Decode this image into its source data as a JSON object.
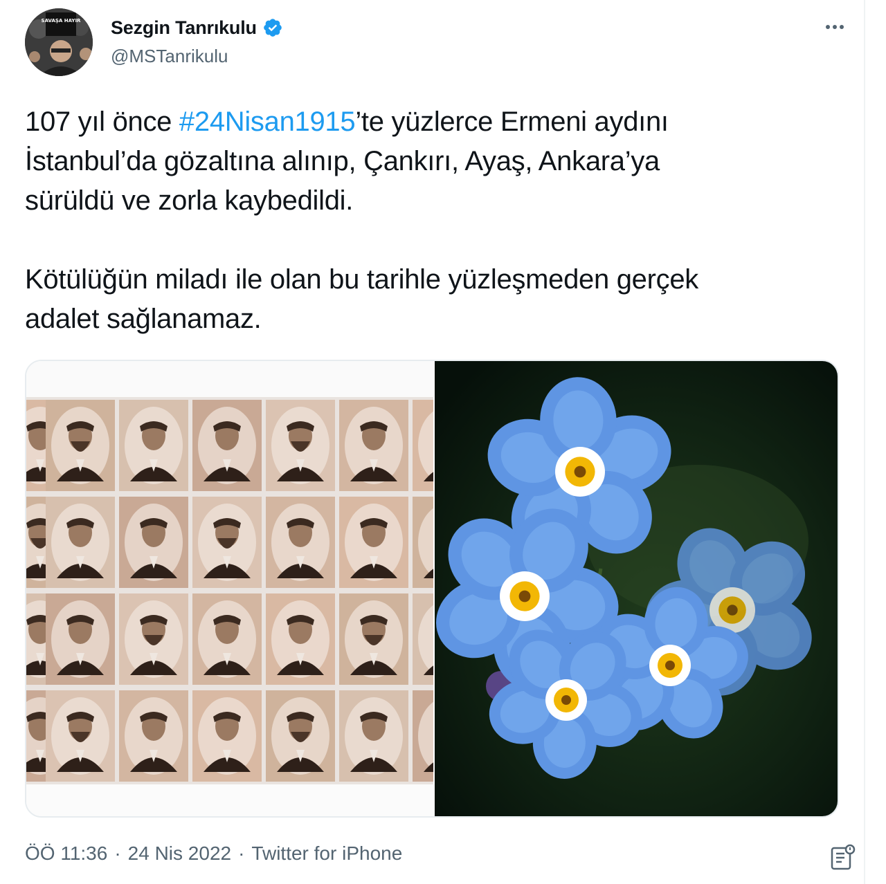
{
  "author": {
    "name": "Sezgin Tanrıkulu",
    "handle": "@MSTanrikulu",
    "avatar_sign": "SAVAŞA HAYIR",
    "verified_color": "#1d9bf0"
  },
  "tweet": {
    "text_part1": "107 yıl önce ",
    "hashtag": "#24Nisan1915",
    "text_part2": "’te yüzlerce Ermeni aydını\nİstanbul’da gözaltına alınıp, Çankırı, Ayaş, Ankara’ya\nsürüldü ve zorla kaybedildi.",
    "paragraph2": "Kötülüğün miladı ile olan bu tarihle yüzleşmeden gerçek\nadalet sağlanamaz."
  },
  "media": {
    "left_image": "portrait-grid",
    "right_image": "forget-me-not-flowers"
  },
  "footer": {
    "time": "ÖÖ 11:36",
    "separator": "·",
    "date": "24 Nis 2022",
    "source": "Twitter for iPhone"
  },
  "icons": {
    "more": "more-options-icon",
    "verified": "verified-badge-icon",
    "analytics": "tweet-analytics-icon"
  },
  "colors": {
    "accent": "#1d9bf0",
    "secondary_text": "#536471",
    "text": "#0f1419"
  }
}
